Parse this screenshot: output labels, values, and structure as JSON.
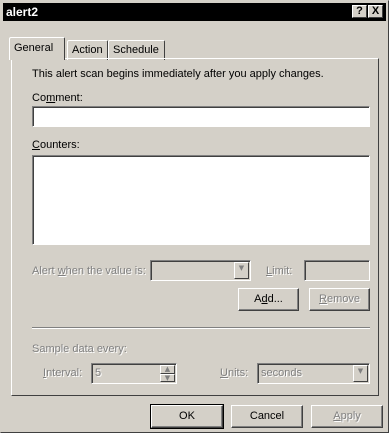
{
  "window": {
    "title": "alert2"
  },
  "caption_buttons": {
    "help": "?",
    "close": "X"
  },
  "tabs": [
    {
      "label": "General",
      "active": true
    },
    {
      "label": "Action",
      "active": false
    },
    {
      "label": "Schedule",
      "active": false
    }
  ],
  "general": {
    "intro_text": "This alert scan begins immediately after you apply changes.",
    "comment_label": "Comment:",
    "comment_value": "",
    "counters_label": "Counters:",
    "alert_when_label": "Alert when the value is:",
    "alert_when_value": "",
    "limit_label": "Limit:",
    "limit_value": "",
    "add_button": "Add...",
    "remove_button": "Remove",
    "sample_label": "Sample data every:",
    "interval_label": "Interval:",
    "interval_value": "5",
    "units_label": "Units:",
    "units_value": "seconds"
  },
  "footer": {
    "ok": "OK",
    "cancel": "Cancel",
    "apply": "Apply"
  }
}
